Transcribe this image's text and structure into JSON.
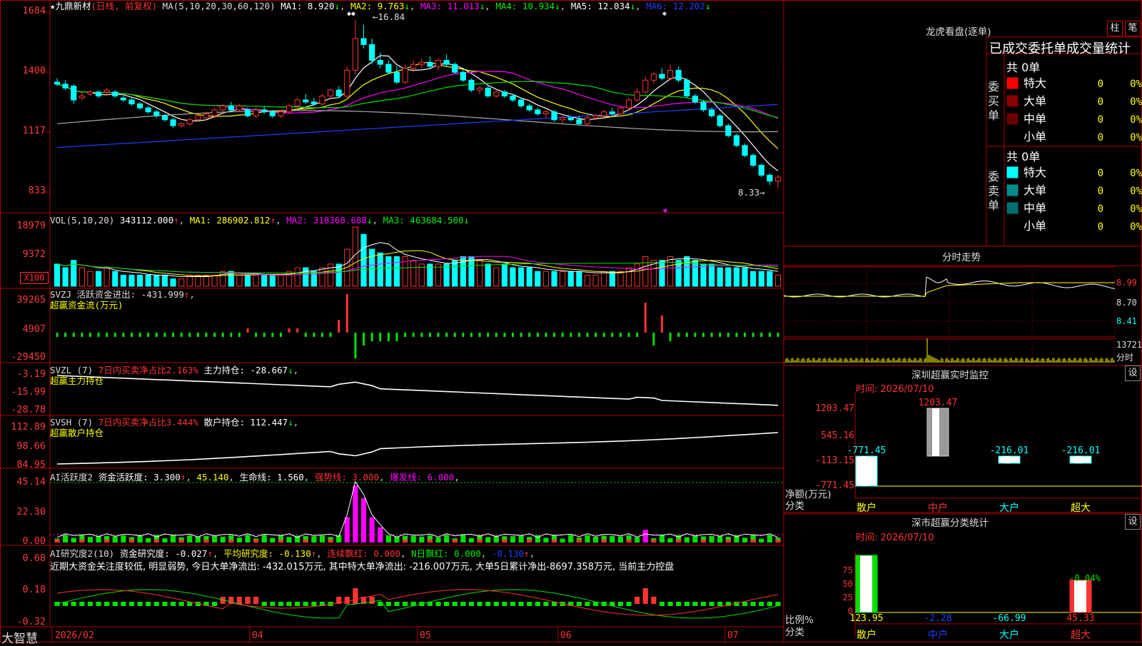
{
  "colors": {
    "up": "#ff3333",
    "down": "#00ffff",
    "grid": "#b00000",
    "white": "#ffffff",
    "yellow": "#ffff00",
    "magenta": "#ff00ff",
    "green": "#00e000",
    "blue": "#2040ff",
    "gray": "#aaaaaa"
  },
  "main": {
    "title": "★九鼎新材",
    "mode": "(日线, 前复权)",
    "ma_head": "MA(5,10,20,30,60,120)",
    "ma": [
      {
        "label": "MA1: 8.920",
        "color": "#ffffff"
      },
      {
        "label": "MA2: 9.763",
        "color": "#ffff00"
      },
      {
        "label": "MA3: 11.013",
        "color": "#ff00ff"
      },
      {
        "label": "MA4: 10.934",
        "color": "#00e000"
      },
      {
        "label": "MA5: 12.034",
        "color": "#ffffff"
      },
      {
        "label": "MA6: 12.202",
        "color": "#2040ff"
      }
    ],
    "high_label": "←16.84",
    "low_label": "8.33→",
    "yaxis": [
      "1684",
      "1400",
      "1117",
      "833"
    ]
  },
  "vol": {
    "head": "VOL(5,10,20)",
    "v": "343112.000",
    "ma1": "MA1: 286902.812",
    "ma2": "MA2: 318368.688",
    "ma3": "MA3: 463684.500",
    "yaxis": [
      "18979",
      "9372"
    ],
    "unit": "X100"
  },
  "svzj": {
    "head": "SVZJ  活跃资金进出: -431.999",
    "sub": "超赢资金流(万元)",
    "yaxis": [
      "39265",
      "4907",
      "-29450"
    ]
  },
  "svzl": {
    "head": "SVZL (7)",
    "pct": "7日内买卖净占比2.163%",
    "val": "主力持仓: -28.667",
    "sub": "超赢主力持仓",
    "yaxis": [
      "-3.19",
      "-15.99",
      "-28.78"
    ]
  },
  "svsh": {
    "head": "SVSH (7)",
    "pct": "7日内买卖净占比3.444%",
    "val": "散户持仓: 112.447",
    "sub": "超赢散户持仓",
    "yaxis": [
      "112.89",
      "98.66",
      "84.95"
    ]
  },
  "ai": {
    "head": "AI活跃度2",
    "v1": "资金活跃度: 3.300",
    "v2": "45.140",
    "v3": "生命线: 1.560",
    "v4": "强势线: 3.000",
    "v5": "爆发线: 6.000",
    "yaxis": [
      "45.14",
      "22.30",
      "0.00"
    ]
  },
  "research": {
    "head": "AI研究度2(10)",
    "v1": "资金研究度: -0.027",
    "v2": "平均研究度: -0.130",
    "v3": "连续飘红: 0.000",
    "v4": "N日飘红: 0.000",
    "v5": "-0.130",
    "comment": "近期大资金关注度较低, 明显弱势, 今日大单净流出: -432.015万元, 其中特大单净流出: -216.007万元, 大单5日累计净出-8697.358万元, 当前主力控盘",
    "yaxis": [
      "0.68",
      "0.18",
      "-0.32"
    ]
  },
  "xaxis": {
    "labels": [
      "2026/02",
      "04",
      "05",
      "06",
      "07"
    ],
    "brand": "大智慧"
  },
  "right": {
    "dragon": {
      "title": "龙虎看盘(逐单)",
      "btn1": "柱",
      "btn2": "笔",
      "tabs": "已成交委托单成交量统计",
      "buy": {
        "side": "委买单",
        "total": "共 0单",
        "rows": [
          {
            "name": "特大",
            "v": "0",
            "p": "0%",
            "c": "#ff0000"
          },
          {
            "name": "大单",
            "v": "0",
            "p": "0%",
            "c": "#8b0000"
          },
          {
            "name": "中单",
            "v": "0",
            "p": "0%",
            "c": "#6b0000"
          },
          {
            "name": "小单",
            "v": "0",
            "p": "0%",
            "c": "#000000"
          }
        ]
      },
      "sell": {
        "side": "委卖单",
        "total": "共 0单",
        "rows": [
          {
            "name": "特大",
            "v": "0",
            "p": "0%",
            "c": "#00ffff"
          },
          {
            "name": "大单",
            "v": "0",
            "p": "0%",
            "c": "#008b8b"
          },
          {
            "name": "中单",
            "v": "0",
            "p": "0%",
            "c": "#007070"
          },
          {
            "name": "小单",
            "v": "0",
            "p": "0%",
            "c": "#000000"
          }
        ]
      }
    },
    "intraday": {
      "title": "分时走势",
      "yaxis": [
        "8.99",
        "8.70",
        "8.41"
      ],
      "vol": "13721",
      "unit": "分时"
    },
    "monitor": {
      "title": "深圳超赢实时监控",
      "btn": "设",
      "time": "时间: 2026/07/10",
      "yaxis": [
        "1203.47",
        "545.16",
        "-113.15",
        "-771.45"
      ],
      "ylabel": "净额(万元)",
      "xlabel": "分类",
      "cats": [
        "散户",
        "中户",
        "大户",
        "超大"
      ]
    },
    "classify": {
      "title": "深市超赢分类统计",
      "btn": "设",
      "time": "时间: 2026/07/10",
      "yaxis": [
        "75",
        "50",
        "25",
        "0"
      ],
      "ylabel": "比例%",
      "xlabel": "分类",
      "cats": [
        "散户",
        "中户",
        "大户",
        "超大"
      ],
      "top_label": "-0.04%"
    }
  },
  "chart_data": [
    {
      "type": "candlestick",
      "title": "九鼎新材",
      "ylim": [
        8.33,
        16.84
      ],
      "high": 16.84,
      "low": 8.33,
      "ohlc": [
        [
          13.7,
          13.9,
          13.5,
          13.6
        ],
        [
          13.6,
          13.8,
          13.3,
          13.4
        ],
        [
          13.5,
          13.6,
          12.6,
          12.8
        ],
        [
          12.9,
          13.2,
          12.8,
          13.0
        ],
        [
          13.1,
          13.3,
          13.0,
          13.2
        ],
        [
          13.2,
          13.3,
          12.9,
          13.0
        ],
        [
          13.2,
          13.4,
          13.0,
          13.3
        ],
        [
          13.2,
          13.3,
          12.9,
          13.0
        ],
        [
          12.9,
          13.0,
          12.7,
          12.8
        ],
        [
          12.8,
          12.9,
          12.5,
          12.6
        ],
        [
          12.6,
          12.7,
          12.3,
          12.4
        ],
        [
          12.4,
          12.5,
          12.1,
          12.2
        ],
        [
          12.2,
          12.3,
          11.9,
          12.0
        ],
        [
          12.0,
          12.1,
          11.7,
          11.8
        ],
        [
          11.8,
          11.9,
          11.4,
          11.5
        ],
        [
          11.5,
          11.7,
          11.4,
          11.6
        ],
        [
          11.6,
          11.9,
          11.5,
          11.8
        ],
        [
          11.8,
          12.1,
          11.7,
          12.0
        ],
        [
          11.9,
          12.2,
          11.8,
          12.1
        ],
        [
          12.0,
          12.4,
          11.9,
          12.3
        ],
        [
          12.3,
          12.6,
          12.1,
          12.5
        ],
        [
          12.5,
          12.7,
          12.2,
          12.3
        ],
        [
          12.3,
          12.6,
          12.2,
          12.5
        ],
        [
          12.3,
          12.4,
          11.9,
          12.0
        ],
        [
          12.0,
          12.4,
          11.9,
          12.3
        ],
        [
          12.3,
          12.5,
          12.1,
          12.2
        ],
        [
          12.2,
          12.3,
          11.9,
          12.0
        ],
        [
          12.0,
          12.3,
          11.9,
          12.2
        ],
        [
          12.2,
          12.6,
          12.1,
          12.5
        ],
        [
          12.5,
          12.9,
          12.4,
          12.8
        ],
        [
          12.8,
          13.1,
          12.6,
          12.7
        ],
        [
          12.7,
          12.9,
          12.5,
          12.6
        ],
        [
          12.6,
          13.1,
          12.5,
          13.0
        ],
        [
          13.0,
          13.4,
          12.9,
          13.3
        ],
        [
          13.3,
          13.5,
          12.9,
          13.0
        ],
        [
          13.0,
          14.5,
          12.9,
          14.3
        ],
        [
          14.3,
          16.84,
          14.1,
          15.9
        ],
        [
          15.9,
          16.6,
          15.4,
          15.6
        ],
        [
          15.6,
          15.9,
          14.6,
          14.8
        ],
        [
          14.8,
          15.2,
          14.4,
          14.6
        ],
        [
          14.6,
          14.8,
          14.1,
          14.2
        ],
        [
          14.2,
          14.5,
          13.6,
          13.7
        ],
        [
          13.7,
          14.6,
          13.6,
          14.4
        ],
        [
          14.4,
          14.8,
          14.2,
          14.6
        ],
        [
          14.6,
          14.9,
          14.4,
          14.7
        ],
        [
          14.7,
          15.0,
          14.4,
          14.5
        ],
        [
          14.5,
          14.9,
          14.3,
          14.8
        ],
        [
          14.8,
          15.1,
          14.5,
          14.6
        ],
        [
          14.6,
          14.7,
          14.1,
          14.2
        ],
        [
          14.2,
          14.3,
          13.7,
          13.8
        ],
        [
          13.8,
          13.9,
          13.2,
          13.3
        ],
        [
          13.3,
          13.5,
          13.1,
          13.4
        ],
        [
          13.4,
          13.5,
          12.9,
          13.0
        ],
        [
          13.0,
          13.3,
          12.9,
          13.2
        ],
        [
          13.2,
          13.3,
          12.9,
          13.0
        ],
        [
          13.0,
          13.1,
          12.7,
          12.8
        ],
        [
          12.8,
          12.9,
          12.4,
          12.5
        ],
        [
          12.5,
          12.6,
          12.2,
          12.3
        ],
        [
          12.3,
          12.4,
          12.0,
          12.1
        ],
        [
          12.1,
          12.3,
          11.9,
          12.2
        ],
        [
          12.2,
          12.3,
          11.7,
          11.8
        ],
        [
          11.8,
          12.0,
          11.6,
          11.9
        ],
        [
          11.9,
          12.0,
          11.7,
          11.8
        ],
        [
          11.8,
          12.0,
          11.5,
          11.6
        ],
        [
          11.6,
          12.0,
          11.5,
          11.9
        ],
        [
          11.9,
          12.1,
          11.8,
          12.0
        ],
        [
          12.0,
          12.3,
          11.9,
          12.2
        ],
        [
          12.2,
          12.4,
          12.0,
          12.1
        ],
        [
          12.1,
          12.5,
          12.0,
          12.4
        ],
        [
          12.4,
          12.9,
          12.3,
          12.8
        ],
        [
          12.8,
          13.4,
          12.7,
          13.2
        ],
        [
          13.2,
          14.0,
          13.1,
          13.8
        ],
        [
          13.8,
          14.2,
          13.6,
          14.1
        ],
        [
          14.1,
          14.4,
          13.8,
          13.9
        ],
        [
          13.9,
          14.6,
          13.8,
          14.3
        ],
        [
          14.3,
          14.5,
          13.7,
          13.8
        ],
        [
          13.8,
          13.9,
          12.9,
          13.0
        ],
        [
          13.0,
          13.1,
          12.6,
          12.7
        ],
        [
          12.7,
          12.8,
          12.2,
          12.3
        ],
        [
          12.3,
          12.4,
          11.9,
          12.0
        ],
        [
          12.0,
          12.1,
          11.4,
          11.5
        ],
        [
          11.5,
          11.6,
          10.9,
          11.0
        ],
        [
          11.0,
          11.1,
          10.4,
          10.5
        ],
        [
          10.5,
          10.6,
          9.9,
          10.0
        ],
        [
          10.0,
          10.1,
          9.4,
          9.5
        ],
        [
          9.5,
          9.6,
          8.9,
          9.0
        ],
        [
          9.0,
          9.1,
          8.5,
          8.7
        ],
        [
          8.7,
          9.0,
          8.33,
          8.9
        ]
      ],
      "ma_series": [
        {
          "name": "MA1",
          "color": "#ffffff"
        },
        {
          "name": "MA2",
          "color": "#ffff00"
        },
        {
          "name": "MA3",
          "color": "#ff00ff"
        },
        {
          "name": "MA4",
          "color": "#00e000"
        },
        {
          "name": "MA5",
          "color": "#aaaaaa"
        },
        {
          "name": "MA6",
          "color": "#2040ff"
        }
      ]
    },
    {
      "type": "bar",
      "name": "VOL",
      "ylim": [
        0,
        18979
      ],
      "values": [
        6,
        5,
        7,
        5,
        4,
        4,
        5,
        4,
        3,
        3,
        3,
        3,
        3,
        3,
        2,
        2,
        3,
        3,
        3,
        3,
        4,
        4,
        3,
        3,
        3,
        3,
        3,
        3,
        4,
        5,
        5,
        4,
        5,
        6,
        6,
        10,
        16,
        14,
        10,
        9,
        8,
        8,
        8,
        7,
        6,
        6,
        6,
        6,
        7,
        8,
        8,
        7,
        6,
        5,
        6,
        5,
        5,
        5,
        4,
        4,
        4,
        4,
        4,
        4,
        3,
        3,
        4,
        4,
        4,
        5,
        6,
        8,
        7,
        7,
        8,
        7,
        8,
        7,
        6,
        6,
        5,
        5,
        5,
        5,
        4,
        4,
        4,
        3
      ]
    },
    {
      "type": "bar",
      "name": "SVZJ",
      "ylim": [
        -29450,
        39265
      ],
      "values": [
        -1,
        -1,
        -1,
        -1,
        -1,
        -1,
        -1,
        -1,
        -1,
        -1,
        -1,
        -1,
        -1,
        -1,
        -1,
        -1,
        -1,
        -1,
        -1,
        -1,
        -1,
        -1,
        -1,
        1,
        -1,
        -1,
        -1,
        -1,
        1,
        1,
        -1,
        -1,
        -1,
        -1,
        3,
        9,
        -6,
        -3,
        -2,
        -2,
        -2,
        -2,
        -1,
        -1,
        -1,
        -1,
        -1,
        -1,
        -1,
        -1,
        -1,
        -1,
        -1,
        -1,
        -1,
        -1,
        -1,
        -1,
        -1,
        -1,
        -1,
        -1,
        -1,
        -1,
        -1,
        -1,
        -1,
        -1,
        -1,
        -1,
        -1,
        7,
        -3,
        4,
        -2,
        -1,
        -1,
        -1,
        -1,
        -1,
        -1,
        -1,
        -1,
        -1,
        -1,
        -1,
        -1,
        -1
      ]
    },
    {
      "type": "line",
      "name": "SVZL",
      "ylim": [
        -28.78,
        -3.19
      ]
    },
    {
      "type": "line",
      "name": "SVSH",
      "ylim": [
        84.95,
        112.89
      ]
    },
    {
      "type": "bar",
      "name": "AI活跃度2",
      "ylim": [
        0,
        45.14
      ]
    },
    {
      "type": "bar",
      "name": "AI研究度2",
      "ylim": [
        -0.32,
        0.68
      ]
    },
    {
      "type": "line",
      "name": "分时走势",
      "ylim": [
        8.41,
        8.99
      ]
    },
    {
      "type": "bar",
      "name": "深圳超赢实时监控",
      "categories": [
        "散户",
        "中户",
        "大户",
        "超大"
      ],
      "values": [
        -771.45,
        1203.47,
        -216.01,
        -216.01
      ],
      "ylim": [
        -771.45,
        1203.47
      ]
    },
    {
      "type": "bar",
      "name": "深市超赢分类统计",
      "categories": [
        "散户",
        "中户",
        "大户",
        "超大"
      ],
      "values": [
        123.95,
        -2.28,
        -66.99,
        45.33
      ],
      "ylim": [
        0,
        75
      ]
    }
  ]
}
